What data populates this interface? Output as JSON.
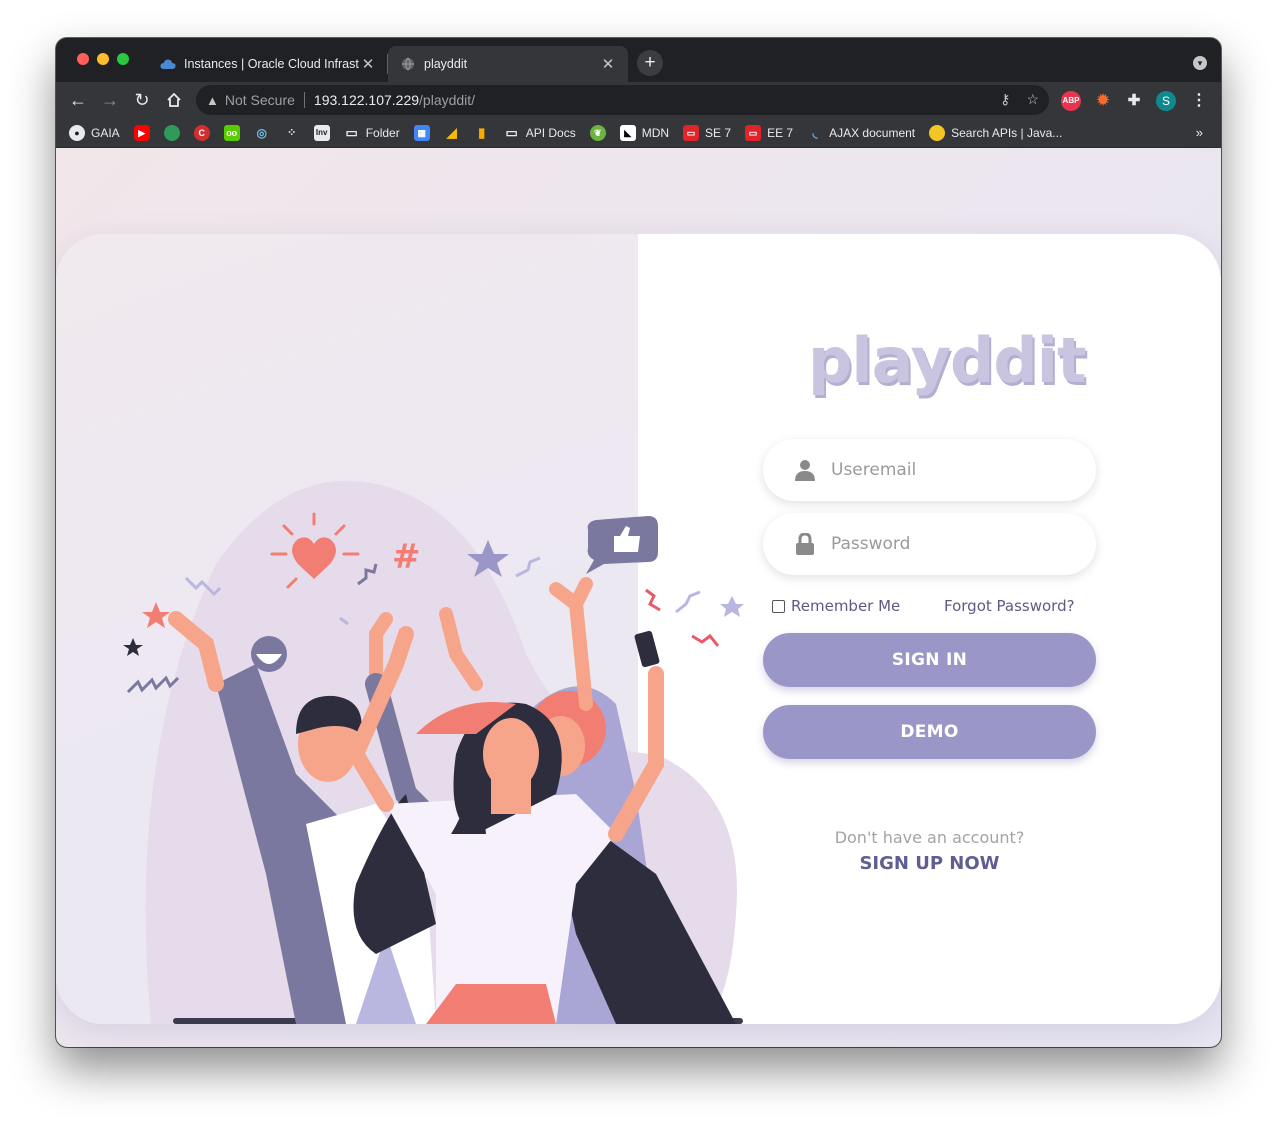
{
  "browser": {
    "tabs": [
      {
        "title": "Instances | Oracle Cloud Infrast",
        "favicon": "cloud-icon",
        "active": false
      },
      {
        "title": "playddit",
        "favicon": "globe-icon",
        "active": true
      }
    ],
    "address": {
      "security_label": "Not Secure",
      "host": "193.122.107.229",
      "path": "/playddit/"
    },
    "profile_initial": "S",
    "extension_abp": "ABP",
    "bookmarks": [
      {
        "label": "GAIA",
        "icon": "github-icon"
      },
      {
        "label": "",
        "icon": "youtube-icon"
      },
      {
        "label": "",
        "icon": "globe-green-icon"
      },
      {
        "label": "",
        "icon": "c-red-icon"
      },
      {
        "label": "",
        "icon": "duolingo-icon"
      },
      {
        "label": "",
        "icon": "swirl-icon"
      },
      {
        "label": "",
        "icon": "dots-icon"
      },
      {
        "label": "",
        "icon": "inv-icon"
      },
      {
        "label": "Folder",
        "icon": "folder-icon"
      },
      {
        "label": "",
        "icon": "calendar-icon"
      },
      {
        "label": "",
        "icon": "ads-icon"
      },
      {
        "label": "",
        "icon": "analytics-icon"
      },
      {
        "label": "API Docs",
        "icon": "folder-icon"
      },
      {
        "label": "",
        "icon": "spring-icon"
      },
      {
        "label": "MDN",
        "icon": "mdn-icon"
      },
      {
        "label": "SE 7",
        "icon": "oracle-icon"
      },
      {
        "label": "EE 7",
        "icon": "oracle-icon"
      },
      {
        "label": "AJAX document",
        "icon": "jquery-icon"
      },
      {
        "label": "Search APIs | Java...",
        "icon": "java-icon"
      }
    ]
  },
  "page": {
    "logo_text": "playddit",
    "email_placeholder": "Useremail",
    "password_placeholder": "Password",
    "remember_label": "Remember Me",
    "forgot_label": "Forgot Password?",
    "signin_label": "SIGN IN",
    "demo_label": "DEMO",
    "no_account_text": "Don't have an account?",
    "signup_label": "SIGN UP NOW"
  },
  "colors": {
    "accent": "#9a97c8",
    "link": "#5d5a86",
    "logo": "#c9c4df"
  }
}
